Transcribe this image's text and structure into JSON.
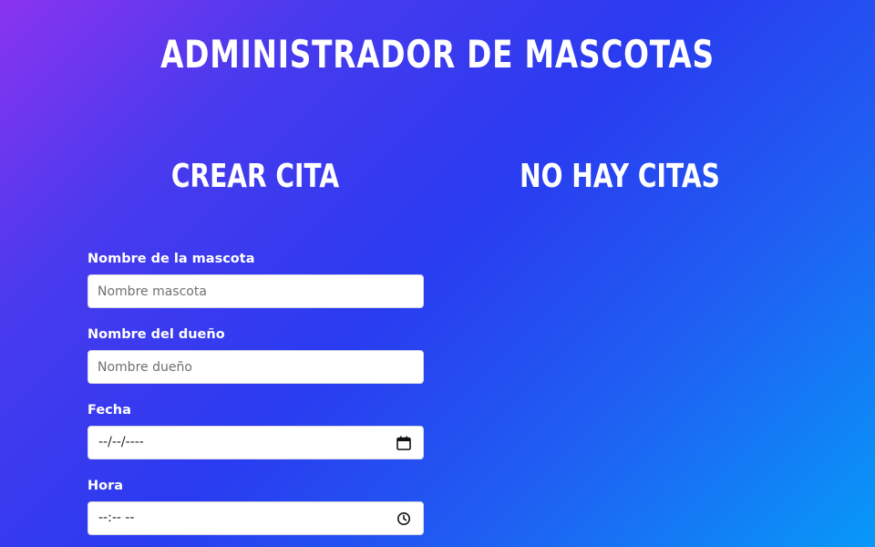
{
  "app": {
    "title": "ADMINISTRADOR DE MASCOTAS"
  },
  "form": {
    "title": "CREAR CITA",
    "fields": [
      {
        "label": "Nombre de la mascota",
        "placeholder": "Nombre mascota",
        "type": "text"
      },
      {
        "label": "Nombre del dueño",
        "placeholder": "Nombre dueño",
        "type": "text"
      },
      {
        "label": "Fecha",
        "value_display": "--/--/----",
        "type": "date",
        "icon": "calendar-icon"
      },
      {
        "label": "Hora",
        "value_display": "--:-- --",
        "type": "time",
        "icon": "clock-icon"
      }
    ]
  },
  "list": {
    "title": "NO HAY CITAS"
  },
  "colors": {
    "gradient_start": "#8a34ef",
    "gradient_mid": "#2a3bf0",
    "gradient_end": "#0799f8",
    "text": "#ffffff",
    "input_bg": "#ffffff"
  }
}
